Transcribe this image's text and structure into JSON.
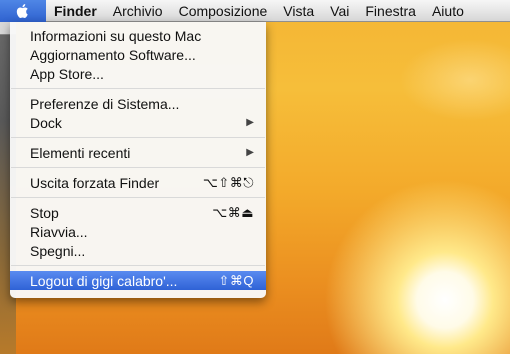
{
  "menubar": {
    "apple_icon": "apple-icon",
    "items": [
      "Finder",
      "Archivio",
      "Composizione",
      "Vista",
      "Vai",
      "Finestra",
      "Aiuto"
    ]
  },
  "apple_menu": {
    "group1": [
      {
        "label": "Informazioni su questo Mac"
      },
      {
        "label": "Aggiornamento Software..."
      },
      {
        "label": "App Store..."
      }
    ],
    "group2": [
      {
        "label": "Preferenze di Sistema..."
      },
      {
        "label": "Dock",
        "submenu": true
      }
    ],
    "group3": [
      {
        "label": "Elementi recenti",
        "submenu": true
      }
    ],
    "group4": [
      {
        "label": "Uscita forzata Finder",
        "shortcut": "⌥⇧⌘⎋"
      }
    ],
    "group5": [
      {
        "label": "Stop",
        "shortcut": "⌥⌘⏏"
      },
      {
        "label": "Riavvia..."
      },
      {
        "label": "Spegni..."
      }
    ],
    "group6": [
      {
        "label": "Logout di gigi calabro'...",
        "shortcut": "⇧⌘Q",
        "selected": true
      }
    ]
  },
  "colors": {
    "selection": "#3a6fdc",
    "menubar": "#e7e7e7",
    "desktop": "#f4b534"
  }
}
